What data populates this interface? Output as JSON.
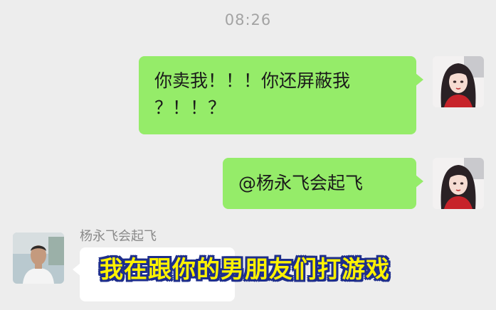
{
  "chat": {
    "timestamp": "08:26",
    "messages": [
      {
        "side": "right",
        "line1": "你卖我！！！你还屏蔽我",
        "line2": "？！！？"
      },
      {
        "side": "right",
        "text": "@杨永飞会起飞"
      }
    ],
    "incoming": {
      "sender_name": "杨永飞会起飞"
    }
  },
  "overlay": {
    "subtitle": "我在跟你的男朋友们打游戏"
  },
  "colors": {
    "background": "#ededed",
    "sent_bubble": "#95ec69",
    "received_bubble": "#ffffff",
    "subtitle_fill": "#fff200",
    "subtitle_outline": "#1e2e8c"
  },
  "icons": {
    "self_avatar": "anime-girl-avatar",
    "other_avatar": "man-photo-avatar"
  }
}
